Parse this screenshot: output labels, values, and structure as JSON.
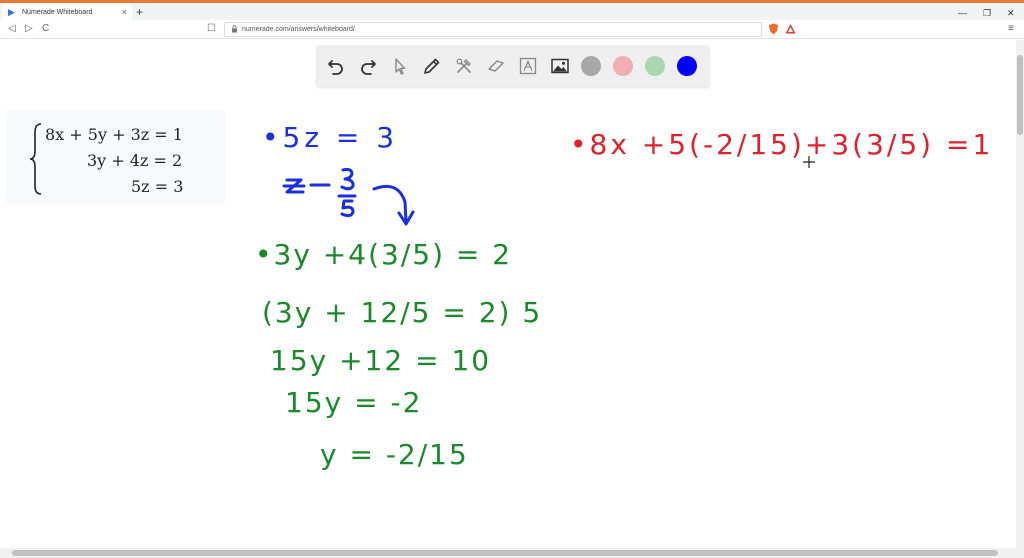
{
  "browser": {
    "tab_title": "Numerade Whiteboard",
    "tab_close": "×",
    "new_tab": "+",
    "minimize": "—",
    "restore": "❐",
    "close": "✕",
    "back": "◁",
    "forward": "▷",
    "reload": "C",
    "bookmark": "☐",
    "lock": "🔒",
    "url": "numerade.com/answers/whiteboard/",
    "menu": "≡"
  },
  "toolbar": {
    "tools": [
      "undo-icon",
      "redo-icon",
      "select-icon",
      "pen-icon",
      "tools-icon",
      "eraser-icon",
      "text-icon",
      "image-icon"
    ],
    "colors": [
      "#a8a8a8",
      "#f2aeb3",
      "#a9d8ae",
      "#0000ff"
    ]
  },
  "problem": {
    "eq1": "8x + 5y + 3z = 1",
    "eq2": "3y + 4z = 2",
    "eq3": "5z = 3"
  },
  "handwriting": {
    "blue_line1": "•5z = 3",
    "blue_line2": "z = 3/5",
    "green_line1": "•3y +4(3/5) = 2",
    "green_line2": "(3y + 12/5 = 2) 5",
    "green_line3": "15y +12 = 10",
    "green_line4": "15y = -2",
    "green_line5": "y = -2/15",
    "red_line1": "•8x +5(-2/15)+3(3/5) =1"
  },
  "colors": {
    "blue_ink": "#1a2fe0",
    "green_ink": "#198a2a",
    "red_ink": "#e0202b"
  }
}
